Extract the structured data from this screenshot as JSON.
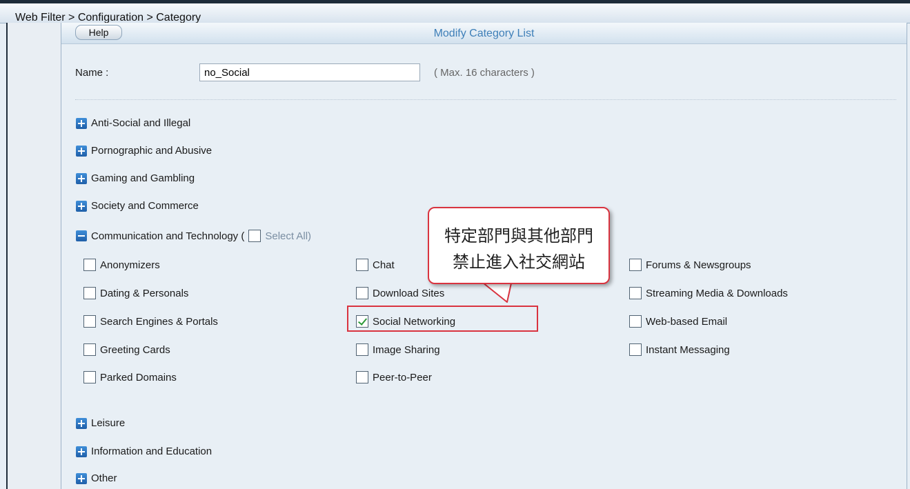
{
  "breadcrumb": "Web Filter > Configuration > Category",
  "help_label": "Help",
  "panel_title": "Modify Category List",
  "name_field": {
    "label": "Name :",
    "value": "no_Social",
    "hint": "( Max. 16 characters )"
  },
  "groups_top": [
    {
      "label": "Anti-Social and Illegal"
    },
    {
      "label": "Pornographic and Abusive"
    },
    {
      "label": "Gaming and Gambling"
    },
    {
      "label": "Society and Commerce"
    }
  ],
  "expanded_group": {
    "label": "Communication and Technology (",
    "select_all": "Select All)",
    "items": [
      {
        "label": "Anonymizers",
        "checked": false
      },
      {
        "label": "Chat",
        "checked": false
      },
      {
        "label": "Forums & Newsgroups",
        "checked": false
      },
      {
        "label": "Dating & Personals",
        "checked": false
      },
      {
        "label": "Download Sites",
        "checked": false
      },
      {
        "label": "Streaming Media & Downloads",
        "checked": false
      },
      {
        "label": "Search Engines & Portals",
        "checked": false
      },
      {
        "label": "Social Networking",
        "checked": true
      },
      {
        "label": "Web-based Email",
        "checked": false
      },
      {
        "label": "Greeting Cards",
        "checked": false
      },
      {
        "label": "Image Sharing",
        "checked": false
      },
      {
        "label": "Instant Messaging",
        "checked": false
      },
      {
        "label": "Parked Domains",
        "checked": false
      },
      {
        "label": "Peer-to-Peer",
        "checked": false
      }
    ]
  },
  "groups_bottom": [
    {
      "label": "Leisure"
    },
    {
      "label": "Information and Education"
    },
    {
      "label": "Other"
    }
  ],
  "callout": {
    "line1": "特定部門與其他部門",
    "line2": "禁止進入社交網站"
  },
  "colors": {
    "accent": "#3e7fb8",
    "highlight": "#d9333f",
    "check": "#2d9a3a"
  }
}
